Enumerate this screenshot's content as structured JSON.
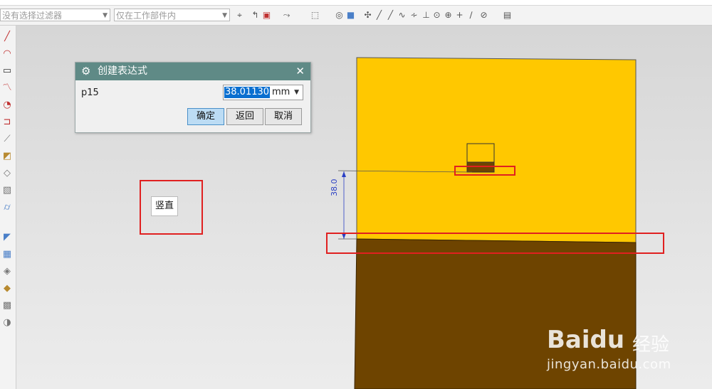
{
  "toolbar": {
    "filter_combo": "没有选择过滤器",
    "scope_combo": "仅在工作部件内",
    "icons": [
      "snap-icon",
      "select-icon",
      "point-icon",
      "rect-select-icon",
      "view-icon",
      "cube-icon",
      "line-icon",
      "arc-icon",
      "curve-icon",
      "point-on-icon",
      "circle-icon",
      "center-icon",
      "plus-icon",
      "slash-icon",
      "face-icon",
      "layer-icon"
    ]
  },
  "left_toolbar": {
    "icons": [
      "line-icon",
      "arc-icon",
      "rectangle-icon",
      "polyline-icon",
      "fillet-icon",
      "offset-icon",
      "trim-icon",
      "extrude-icon",
      "revolve-icon",
      "sweep-icon",
      "cylinder-icon",
      "surface-icon",
      "mesh-icon",
      "blend-icon",
      "sew-icon",
      "trim-body-icon",
      "tube-icon"
    ]
  },
  "dialog": {
    "title": "创建表达式",
    "name": "p15",
    "value": "38.01130",
    "unit": "mm",
    "ok_label": "确定",
    "back_label": "返回",
    "cancel_label": "取消"
  },
  "tooltip": "竖直",
  "dimension_label": "38.0",
  "watermark": {
    "brand": "Baidu",
    "suffix": "经验",
    "url": "jingyan.baidu.com"
  },
  "colors": {
    "part_top": "#ffc800",
    "part_bottom": "#6e4400",
    "dialog_title": "#5f8a86",
    "highlight": "#e02020",
    "dimension": "#2a3fc4"
  }
}
